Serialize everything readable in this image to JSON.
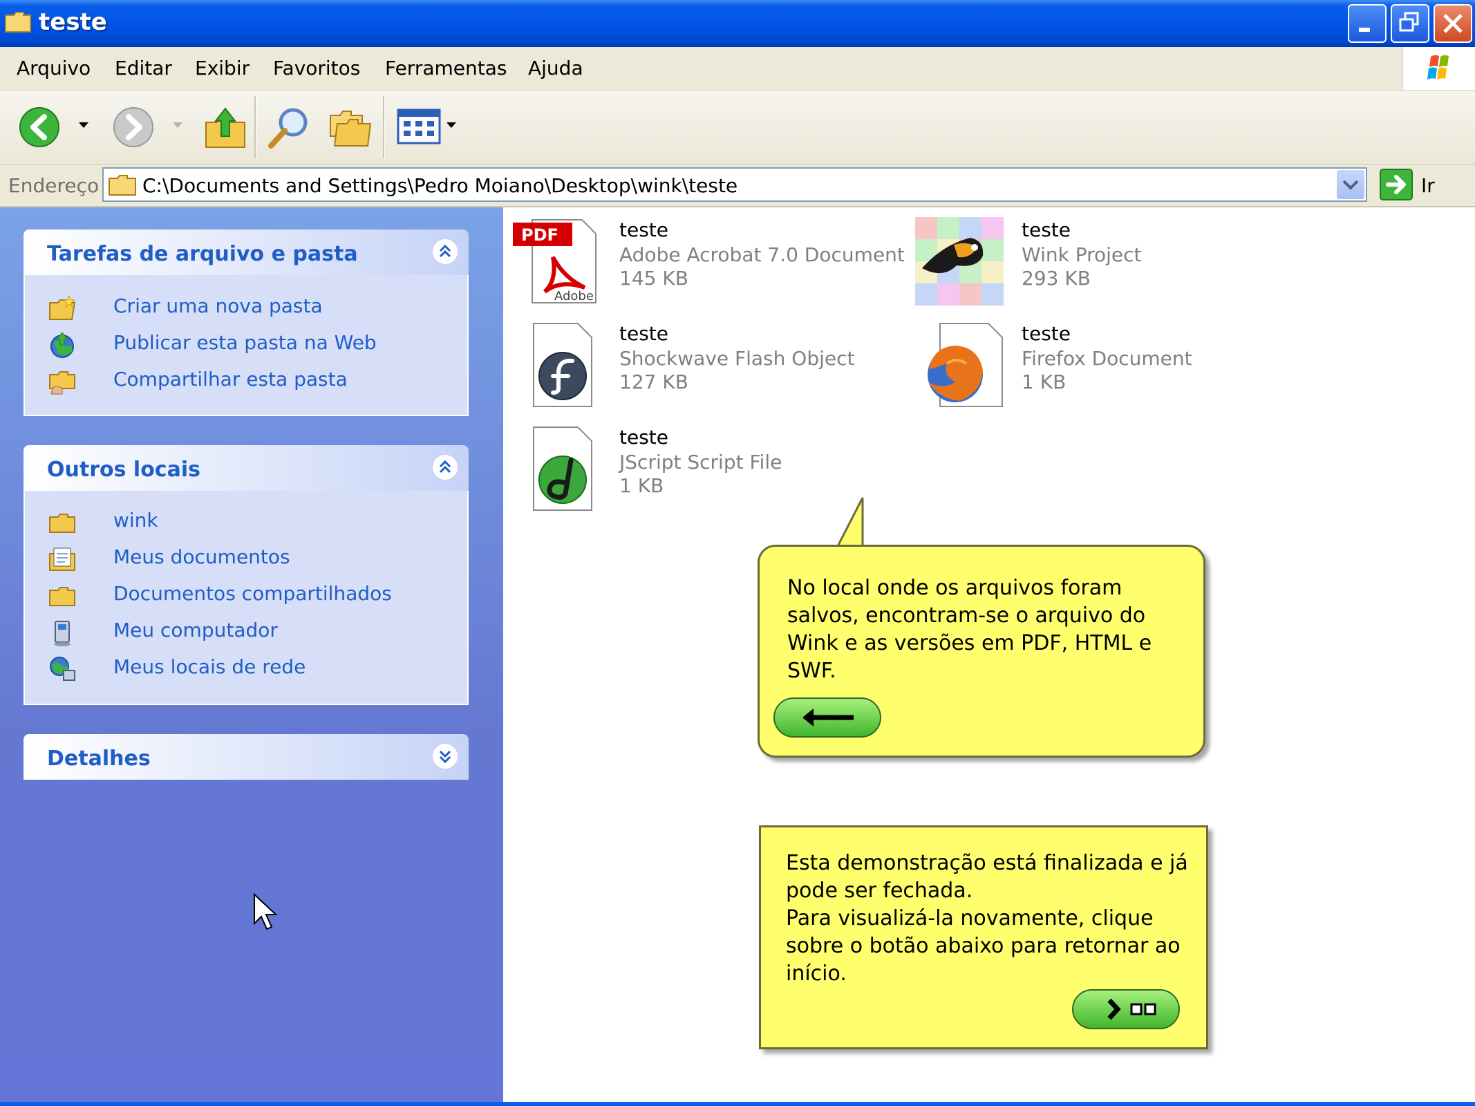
{
  "window": {
    "title": "teste"
  },
  "menu": [
    "Arquivo",
    "Editar",
    "Exibir",
    "Favoritos",
    "Ferramentas",
    "Ajuda"
  ],
  "toolbar": {
    "back": "back-arrow",
    "forward": "forward-arrow",
    "up": "folder-up",
    "search": "search",
    "folders": "folders",
    "views": "views"
  },
  "address": {
    "label": "Endereço",
    "path": "C:\\Documents and Settings\\Pedro Moiano\\Desktop\\wink\\teste",
    "go_label": "Ir"
  },
  "left_panels": {
    "tasks": {
      "title": "Tarefas de arquivo e pasta",
      "items": [
        {
          "label": "Criar uma nova pasta",
          "icon": "new-folder-icon"
        },
        {
          "label": "Publicar esta pasta na Web",
          "icon": "publish-web-icon"
        },
        {
          "label": "Compartilhar esta pasta",
          "icon": "share-folder-icon"
        }
      ]
    },
    "other_places": {
      "title": "Outros locais",
      "items": [
        {
          "label": "wink",
          "icon": "folder-icon"
        },
        {
          "label": "Meus documentos",
          "icon": "my-documents-icon"
        },
        {
          "label": "Documentos compartilhados",
          "icon": "folder-icon"
        },
        {
          "label": "Meu computador",
          "icon": "my-computer-icon"
        },
        {
          "label": "Meus locais de rede",
          "icon": "network-places-icon"
        }
      ]
    },
    "details": {
      "title": "Detalhes"
    }
  },
  "files": [
    {
      "name": "teste",
      "type": "Adobe Acrobat 7.0 Document",
      "size": "145 KB",
      "icon": "pdf-icon"
    },
    {
      "name": "teste",
      "type": "Wink Project",
      "size": "293 KB",
      "icon": "wink-project-icon"
    },
    {
      "name": "teste",
      "type": "Shockwave Flash Object",
      "size": "127 KB",
      "icon": "flash-icon"
    },
    {
      "name": "teste",
      "type": "Firefox Document",
      "size": "1 KB",
      "icon": "firefox-icon"
    },
    {
      "name": "teste",
      "type": "JScript Script File",
      "size": "1 KB",
      "icon": "jscript-icon"
    }
  ],
  "callouts": {
    "first": {
      "text_lines": [
        "No local onde os arquivos foram",
        "salvos, encontram-se o arquivo do",
        "Wink e as versões em PDF, HTML e",
        "SWF."
      ],
      "button_icon": "left-arrow-icon"
    },
    "second": {
      "text_lines": [
        "Esta demonstração está finalizada e já",
        "pode ser fechada.",
        "Para visualizá-la novamente, clique",
        "sobre o botão abaixo para retornar ao",
        "início."
      ],
      "button_icon": "restart-icon"
    }
  },
  "colors": {
    "titlebar": "#0055e5",
    "link": "#215dc6",
    "callout": "#ffff6e",
    "pill_button": "#41b52c"
  }
}
